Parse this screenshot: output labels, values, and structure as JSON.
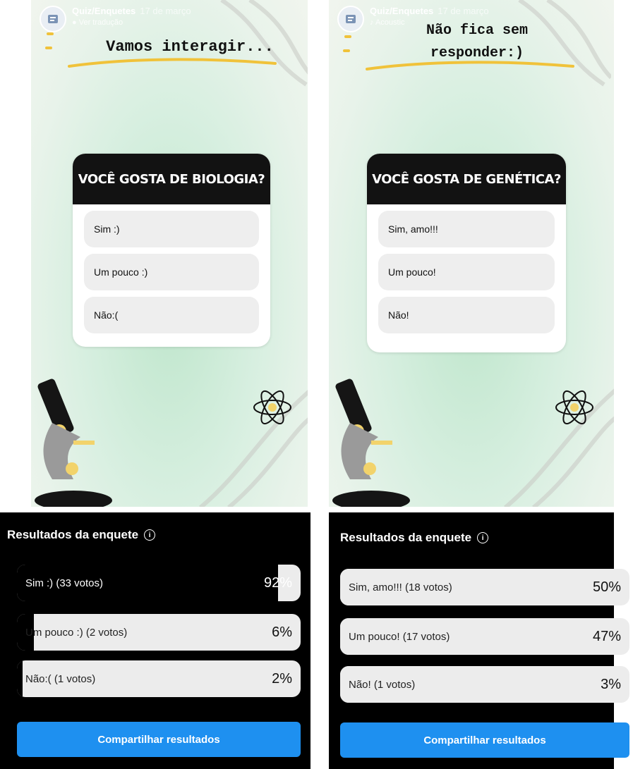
{
  "left_story": {
    "account": "Quiz/Enquetes",
    "date": "17 de março",
    "subtext": "Ver tradução",
    "headline": "Vamos interagir...",
    "question": "Você gosta de biologia?",
    "options": [
      "Sim :)",
      "Um pouco :)",
      "Não:("
    ]
  },
  "right_story": {
    "account": "Quiz/Enquetes",
    "date": "17 de março",
    "subtext": "Acoustic",
    "headline_line1": "Não fica sem",
    "headline_line2": "responder:)",
    "question": "Você gosta de genética?",
    "options": [
      "Sim, amo!!!",
      "Um pouco!",
      "Não!"
    ]
  },
  "left_results": {
    "title": "Resultados da enquete",
    "rows": [
      {
        "label": "Sim :) (33 votos)",
        "pct_label": "92%",
        "fill": 0.92
      },
      {
        "label": "Um pouco :) (2 votos)",
        "pct_label": "6%",
        "fill": 0.06
      },
      {
        "label": "Não:( (1 votos)",
        "pct_label": "2%",
        "fill": 0.02
      }
    ],
    "share_label": "Compartilhar resultados"
  },
  "right_results": {
    "title": "Resultados da enquete",
    "rows": [
      {
        "label": "Sim, amo!!! (18 votos)",
        "pct_label": "50%",
        "fill": 0.5
      },
      {
        "label": "Um pouco! (17 votos)",
        "pct_label": "47%",
        "fill": 0.47
      },
      {
        "label": "Não! (1 votos)",
        "pct_label": "3%",
        "fill": 0.03
      }
    ],
    "share_label": "Compartilhar resultados"
  },
  "colors": {
    "accent": "#1e90f0",
    "card_header": "#121212",
    "underline": "#f0c23a"
  },
  "icons": [
    "avatar-icon",
    "translate-icon",
    "microscope-icon",
    "atom-icon",
    "dna-icon",
    "info-icon"
  ]
}
